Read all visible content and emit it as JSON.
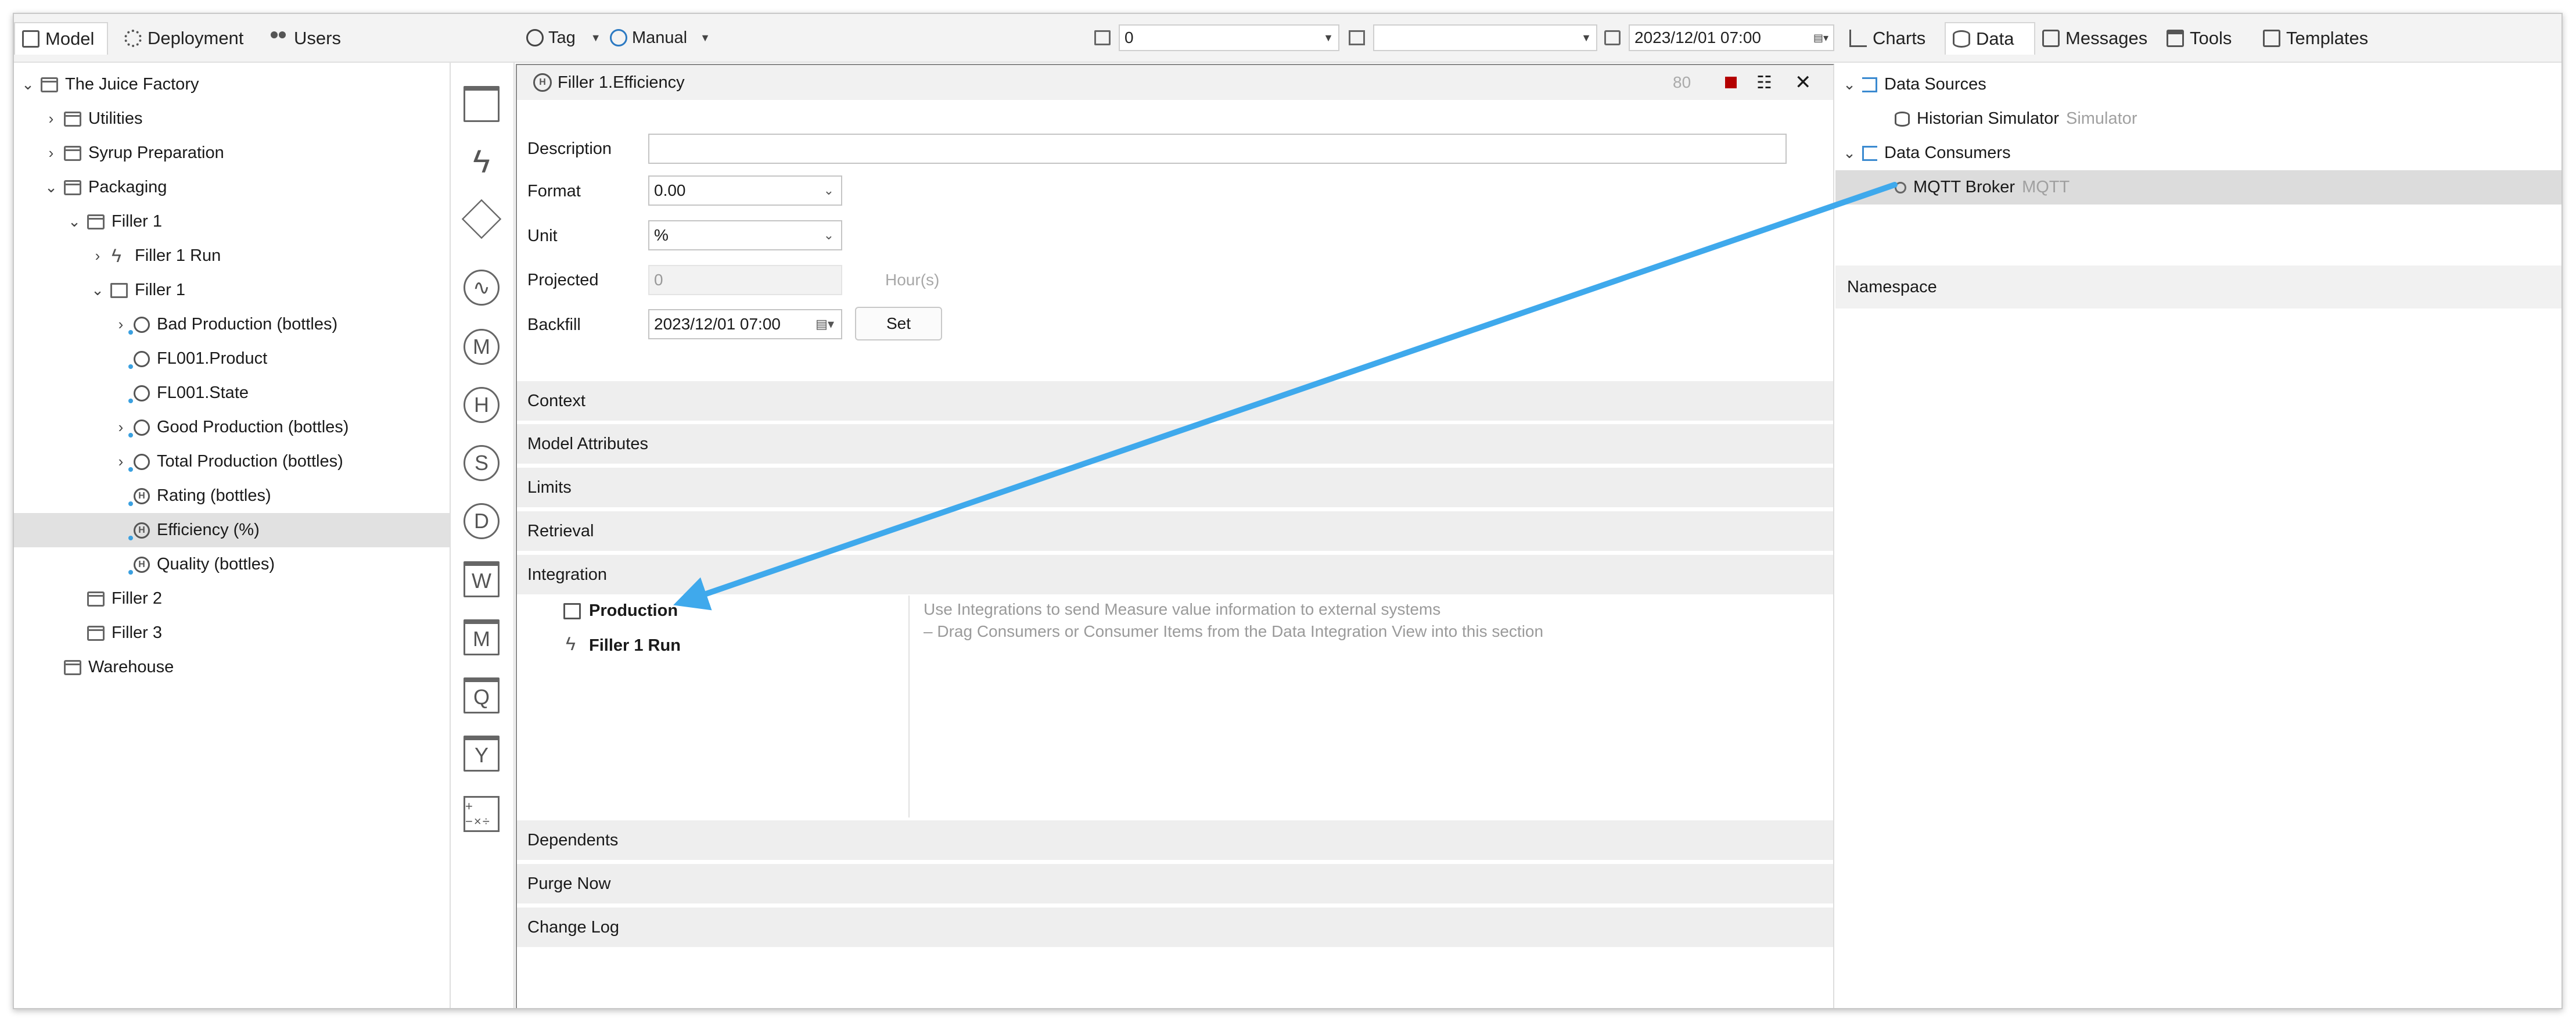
{
  "top_tabs": {
    "model": "Model",
    "deployment": "Deployment",
    "users": "Users",
    "charts": "Charts",
    "data": "Data",
    "messages": "Messages",
    "tools": "Tools",
    "templates": "Templates"
  },
  "toolbar": {
    "tag_label": "Tag",
    "mode_label": "Manual",
    "grid_value": "0",
    "range_value": "",
    "date_value": "2023/12/01 07:00"
  },
  "tree": {
    "items": [
      {
        "label": "The Juice Factory",
        "chevron": "⌄",
        "icon": "folder"
      },
      {
        "label": "Utilities",
        "chevron": "›",
        "icon": "folder"
      },
      {
        "label": "Syrup Preparation",
        "chevron": "›",
        "icon": "folder"
      },
      {
        "label": "Packaging",
        "chevron": "⌄",
        "icon": "folder"
      },
      {
        "label": "Filler 1",
        "chevron": "⌄",
        "icon": "folder"
      },
      {
        "label": "Filler 1 Run",
        "chevron": "›",
        "icon": "bolt"
      },
      {
        "label": "Filler 1",
        "chevron": "⌄",
        "icon": "cube"
      },
      {
        "label": "Bad Production (bottles)",
        "chevron": "›",
        "icon": "trend"
      },
      {
        "label": "FL001.Product",
        "chevron": "",
        "icon": "trend"
      },
      {
        "label": "FL001.State",
        "chevron": "",
        "icon": "trend"
      },
      {
        "label": "Good Production (bottles)",
        "chevron": "›",
        "icon": "trend"
      },
      {
        "label": "Total Production (bottles)",
        "chevron": "›",
        "icon": "trend"
      },
      {
        "label": "Rating (bottles)",
        "chevron": "",
        "icon": "hcirc"
      },
      {
        "label": "Efficiency (%)",
        "chevron": "",
        "icon": "hcirc"
      },
      {
        "label": "Quality (bottles)",
        "chevron": "",
        "icon": "hcirc"
      },
      {
        "label": "Filler 2",
        "chevron": "",
        "icon": "folder"
      },
      {
        "label": "Filler 3",
        "chevron": "",
        "icon": "folder"
      },
      {
        "label": "Warehouse",
        "chevron": "",
        "icon": "folder"
      }
    ]
  },
  "toolbox": {
    "m": "M",
    "h": "H",
    "s": "S",
    "d": "D",
    "w": "W",
    "m2": "M",
    "q": "Q",
    "y": "Y",
    "calc": "+−×÷"
  },
  "editor": {
    "title": "Filler 1.Efficiency",
    "title_icon": "H",
    "count": "80",
    "description_label": "Description",
    "description_value": "",
    "format_label": "Format",
    "format_value": "0.00",
    "unit_label": "Unit",
    "unit_value": "%",
    "projected_label": "Projected",
    "projected_value": "0",
    "projected_unit": "Hour(s)",
    "backfill_label": "Backfill",
    "backfill_value": "2023/12/01 07:00",
    "set_label": "Set",
    "sections": {
      "context": "Context",
      "model_attributes": "Model Attributes",
      "limits": "Limits",
      "retrieval": "Retrieval",
      "integration": "Integration",
      "dependents": "Dependents",
      "purge_now": "Purge Now",
      "change_log": "Change Log"
    },
    "integration_items": [
      "Production",
      "Filler 1 Run"
    ],
    "integration_help_1": "Use Integrations to send Measure value information to external systems",
    "integration_help_2": "– Drag Consumers or Consumer Items from the Data Integration View into this section"
  },
  "right_panel": {
    "data_sources": "Data Sources",
    "historian": "Historian Simulator",
    "historian_type": "Simulator",
    "data_consumers": "Data Consumers",
    "broker": "MQTT Broker",
    "broker_type": "MQTT",
    "namespace": "Namespace"
  },
  "colors": {
    "arrow": "#3fa9ec",
    "selection": "#e1e1e1",
    "stop": "#b40000"
  }
}
